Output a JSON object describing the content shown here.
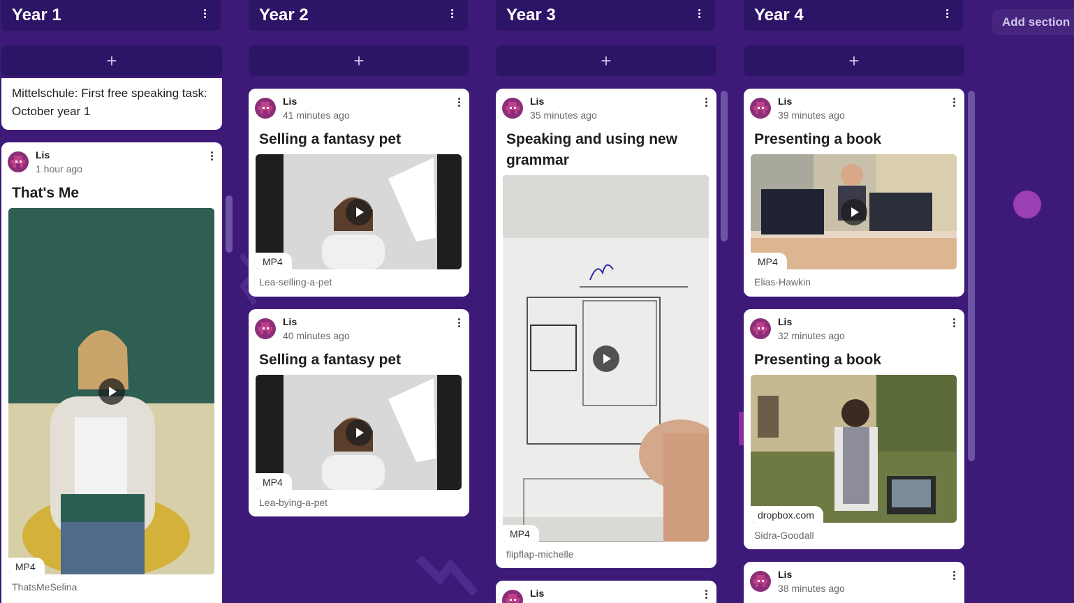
{
  "add_section_label": "Add section",
  "add_post_symbol": "+",
  "columns": [
    {
      "title": "Year 1",
      "partial_text": "Mittelschule: First free speaking task: October year 1",
      "posts": [
        {
          "author": "Lis",
          "time": "1 hour ago",
          "title": "That's Me",
          "media_type": "MP4",
          "caption": "ThatsMeSelina"
        }
      ]
    },
    {
      "title": "Year 2",
      "posts": [
        {
          "author": "Lis",
          "time": "41 minutes ago",
          "title": "Selling a fantasy pet",
          "media_type": "MP4",
          "caption": "Lea-selling-a-pet"
        },
        {
          "author": "Lis",
          "time": "40 minutes ago",
          "title": "Selling a fantasy pet",
          "media_type": "MP4",
          "caption": "Lea-bying-a-pet"
        }
      ]
    },
    {
      "title": "Year 3",
      "posts": [
        {
          "author": "Lis",
          "time": "35 minutes ago",
          "title": "Speaking and using new grammar",
          "media_type": "MP4",
          "caption": "flipflap-michelle"
        },
        {
          "author": "Lis"
        }
      ]
    },
    {
      "title": "Year 4",
      "posts": [
        {
          "author": "Lis",
          "time": "39 minutes ago",
          "title": "Presenting a book",
          "media_type": "MP4",
          "caption": "Elias-Hawkin"
        },
        {
          "author": "Lis",
          "time": "32 minutes ago",
          "title": "Presenting a book",
          "media_type": "dropbox.com",
          "caption": "Sidra-Goodall"
        },
        {
          "author": "Lis",
          "time": "38 minutes ago"
        }
      ]
    }
  ],
  "colors": {
    "background": "#3d1a78",
    "column_header": "#2c1566",
    "card": "#ffffff",
    "avatar": "#8a2f78"
  }
}
